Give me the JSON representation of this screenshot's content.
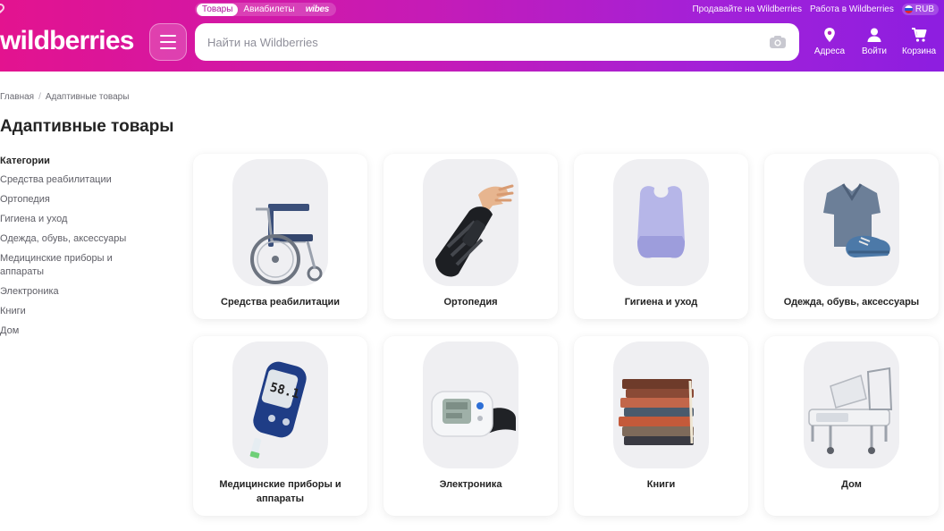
{
  "colors": {
    "brand_start": "#e3138f",
    "brand_end": "#8d1ee0",
    "text": "#242424",
    "muted": "#5e5e66"
  },
  "header": {
    "top_tabs": [
      "Товары",
      "Авиабилеты",
      "wibes"
    ],
    "links": [
      "Продавайте на Wildberries",
      "Работа в Wildberries"
    ],
    "currency": "RUB",
    "logo": "wildberries",
    "search_placeholder": "Найти на Wildberries",
    "actions": [
      {
        "label": "Адреса",
        "icon": "location-pin-icon"
      },
      {
        "label": "Войти",
        "icon": "user-icon"
      },
      {
        "label": "Корзина",
        "icon": "cart-icon"
      }
    ]
  },
  "breadcrumbs": [
    "Главная",
    "Адаптивные товары"
  ],
  "page_title": "Адаптивные товары",
  "sidebar": {
    "heading": "Категории",
    "items": [
      "Средства реабилитации",
      "Ортопедия",
      "Гигиена и уход",
      "Одежда, обувь, аксессуары",
      "Медицинские приборы и аппараты",
      "Электроника",
      "Книги",
      "Дом"
    ]
  },
  "categories": [
    {
      "label": "Средства реабилитации",
      "icon": "wheelchair-icon"
    },
    {
      "label": "Ортопедия",
      "icon": "wrist-brace-icon"
    },
    {
      "label": "Гигиена и уход",
      "icon": "bib-icon"
    },
    {
      "label": "Одежда, обувь, аксессуары",
      "icon": "clothing-icon"
    },
    {
      "label": "Медицинские приборы и аппараты",
      "icon": "glucometer-icon"
    },
    {
      "label": "Электроника",
      "icon": "blood-pressure-monitor-icon"
    },
    {
      "label": "Книги",
      "icon": "books-icon"
    },
    {
      "label": "Дом",
      "icon": "hospital-bed-icon"
    }
  ],
  "glucometer_reading": "58.1"
}
